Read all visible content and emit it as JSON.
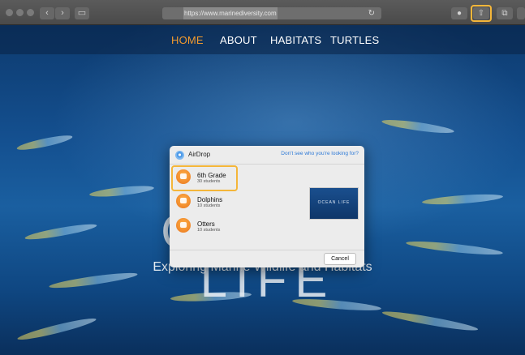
{
  "browser": {
    "url": "https://www.marinediversity.com"
  },
  "site": {
    "nav": [
      "HOME",
      "ABOUT",
      "HABITATS",
      "TURTLES"
    ],
    "active_nav": "HOME",
    "hero_title": "OCEAN LIFE",
    "hero_subtitle": "Exploring Marine Wildlife and Habitats"
  },
  "airdrop": {
    "title": "AirDrop",
    "help_link": "Don't see who you're looking for?",
    "recipients": [
      {
        "name": "6th Grade",
        "count": "30 students",
        "selected": true
      },
      {
        "name": "Dolphins",
        "count": "10 students",
        "selected": false
      },
      {
        "name": "Otters",
        "count": "10 students",
        "selected": false
      }
    ],
    "preview_text": "OCEAN LIFE",
    "cancel_label": "Cancel"
  },
  "colors": {
    "accent_nav": "#f29a2e",
    "highlight": "#f4b63a",
    "link": "#2d79d6"
  },
  "icons": {
    "traffic_lights": "traffic-light-icon",
    "back": "back-chevron-icon",
    "forward": "forward-chevron-icon",
    "sidebar": "sidebar-icon",
    "reload": "reload-icon",
    "download": "download-icon",
    "share": "share-icon",
    "tabs": "tabs-icon"
  }
}
